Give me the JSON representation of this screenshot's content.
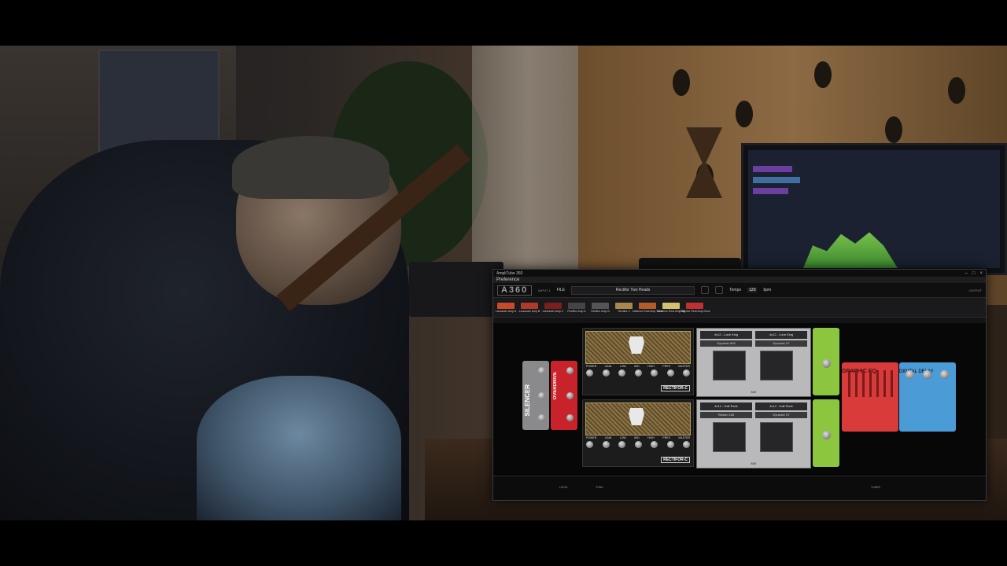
{
  "app": {
    "window_title": "AmpliTube 360",
    "menu_label": "Preference",
    "logo": "A360",
    "file_label": "FILE",
    "preset_name": "Rectifor Two Heads",
    "tempo_label": "Tempo",
    "tempo_value": "120",
    "tempo_unit": "bpm",
    "toolbar_small_1": "INPUT 1",
    "toolbar_small_2": "OUTPUT"
  },
  "chain": [
    {
      "label": "Lancaster Amp A",
      "color": "#c84a2a"
    },
    {
      "label": "Lancaster Amp B",
      "color": "#b03a2a"
    },
    {
      "label": "Lancaster Amp C",
      "color": "#7a1e1e"
    },
    {
      "label": "Rectifor Amp A",
      "color": "#444444"
    },
    {
      "label": "Rectifor Amp B",
      "color": "#555555"
    },
    {
      "label": "Rectifor 3",
      "color": "#a8884a"
    },
    {
      "label": "Cadence Real Amp Valve",
      "color": "#b65a2a"
    },
    {
      "label": "Cadence Real Amp Sig",
      "color": "#d4c070"
    },
    {
      "label": "Cadence Real Amp Drive",
      "color": "#c03030"
    }
  ],
  "amps": [
    {
      "brand": "RECTIFOR-C",
      "knobs": [
        "POWER",
        "GAIN",
        "LOW",
        "MID",
        "HIGH",
        "PRES",
        "MASTER"
      ]
    },
    {
      "brand": "RECTIFOR-C",
      "knobs": [
        "POWER",
        "GAIN",
        "LOW",
        "MID",
        "HIGH",
        "PRES",
        "MASTER"
      ]
    }
  ],
  "cabs": [
    {
      "cab_a": "4x12 - Lone King",
      "cab_b": "4x12 - Lone King",
      "mic_a": "Dynamic 609",
      "mic_b": "Dynamic 57",
      "mix": "MIX",
      "vol": "VOL"
    },
    {
      "cab_a": "4x12 - Half Rack",
      "cab_b": "4x12 - Half Rack",
      "mic_a": "Ribbon 160",
      "mic_b": "Dynamic 57",
      "mix": "MIX",
      "vol": "VOL"
    }
  ],
  "pedals": {
    "silencer": "SILENCER",
    "overdrive": "OVERDRIVE",
    "graphic_eq": "GRAPHIC EQ",
    "digital_delay": "DIGITAL DELAY"
  },
  "bottom": {
    "input_lbl": "LEVEL",
    "tone_lbl": "TONE",
    "tuner_lbl": "TUNER"
  }
}
